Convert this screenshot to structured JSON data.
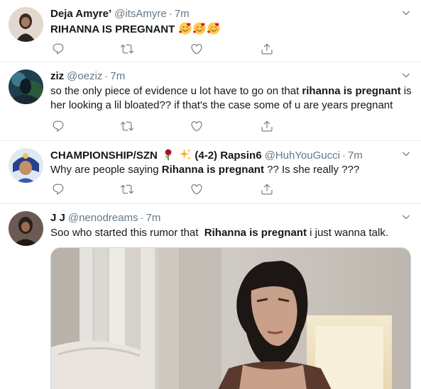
{
  "tweets": [
    {
      "name": "Deja Amyre’",
      "handle": "@itsAmyre",
      "dot": "·",
      "time": "7m",
      "text_before": "RIHANNA IS PREGNANT",
      "bold": "",
      "text_after": "",
      "emoji_icons": [
        "smiling-face-with-hearts-icon",
        "smiling-face-with-hearts-icon",
        "smiling-face-with-hearts-icon"
      ]
    },
    {
      "name": "ziz",
      "handle": "@oeziz",
      "dot": "·",
      "time": "7m",
      "text_before": "so the only piece of evidence u lot have to go on that ",
      "bold": "rihanna is pregnant",
      "text_after": " is her looking a lil bloated?? if that's the case some of u are years pregnant"
    },
    {
      "name": "CHAMPIONSHIP/SZN",
      "name_suffix": "(4-2) Rapsin6",
      "handle": "@HuhYouGucci",
      "dot": "·",
      "time": "7m",
      "text_before": "Why are people saying ",
      "bold": "Rihanna is pregnant",
      "text_after": " ?? Is she really ???",
      "name_icons": [
        "rose-icon",
        "sparkles-icon"
      ]
    },
    {
      "name": "J J",
      "handle": "@nenodreams",
      "dot": "·",
      "time": "7m",
      "text_before": "Soo who started this rumor that  ",
      "bold": "Rihanna is pregnant",
      "text_after": " i just wanna talk.",
      "media": "video-frame-woman-short-dark-hair"
    }
  ],
  "action_icons": [
    "reply-icon",
    "retweet-icon",
    "like-icon",
    "share-icon"
  ],
  "colors": {
    "text": "#14171a",
    "secondary": "#657786",
    "border": "#e6ecf0",
    "background": "#ffffff"
  }
}
